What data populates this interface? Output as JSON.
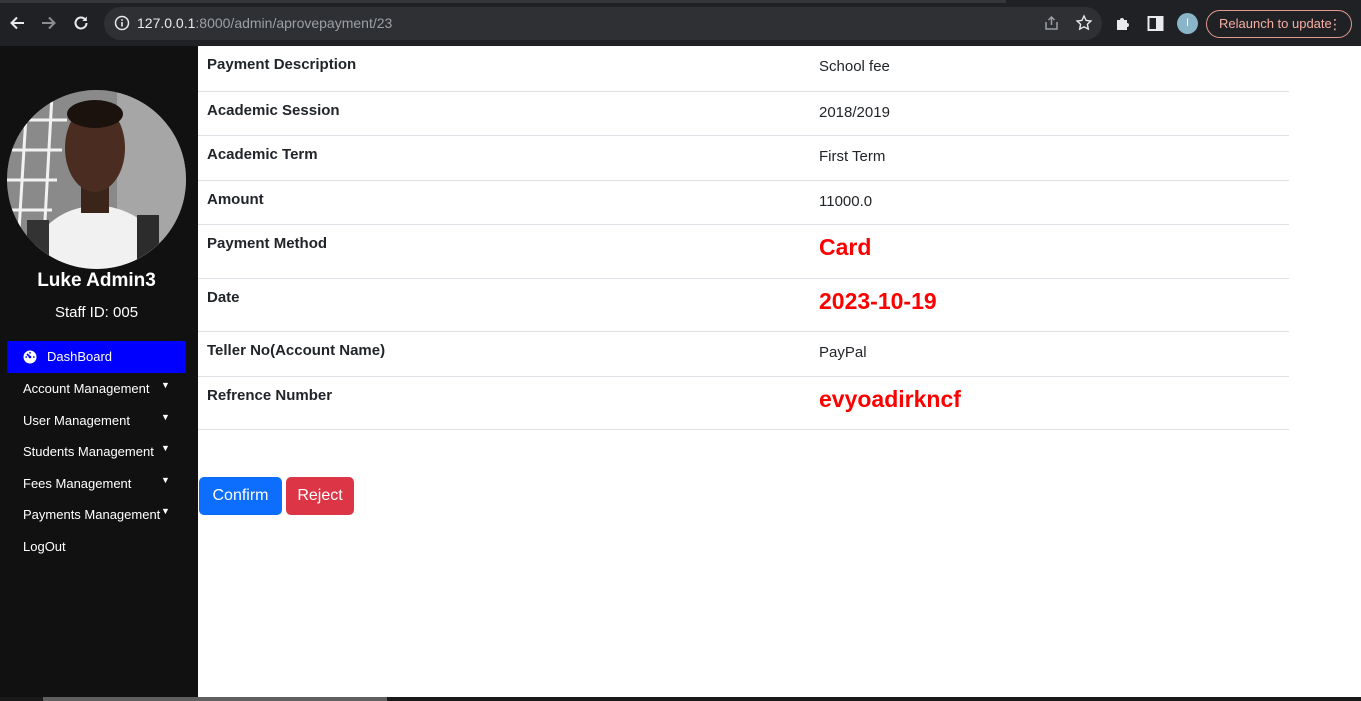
{
  "browser": {
    "url_host": "127.0.0.1",
    "url_path": ":8000/admin/aprovepayment/23",
    "relaunch_label": "Relaunch to update",
    "profile_initial": "I"
  },
  "sidebar": {
    "user_name": "Luke Admin3",
    "staff_id": "Staff ID: 005",
    "items": [
      {
        "label": "DashBoard"
      },
      {
        "label": "Account Management"
      },
      {
        "label": "User Management"
      },
      {
        "label": "Students Management"
      },
      {
        "label": "Fees Management"
      },
      {
        "label": "Payments Management"
      },
      {
        "label": "LogOut"
      }
    ]
  },
  "payment": {
    "rows": [
      {
        "label": "Payment Description",
        "value": "School fee"
      },
      {
        "label": "Academic Session",
        "value": "2018/2019"
      },
      {
        "label": "Academic Term",
        "value": "First Term"
      },
      {
        "label": "Amount",
        "value": "11000.0"
      },
      {
        "label": "Payment Method",
        "value": "Card"
      },
      {
        "label": "Date",
        "value": "2023-10-19"
      },
      {
        "label": "Teller No(Account Name)",
        "value": "PayPal"
      },
      {
        "label": "Refrence Number",
        "value": "evyoadirkncf"
      }
    ]
  },
  "actions": {
    "confirm_label": "Confirm",
    "reject_label": "Reject"
  },
  "colors": {
    "primary": "#0d6efd",
    "danger": "#dc3545",
    "highlight_text": "#ff0000",
    "sidebar_bg": "#111111",
    "active_menu": "#0000ff"
  }
}
